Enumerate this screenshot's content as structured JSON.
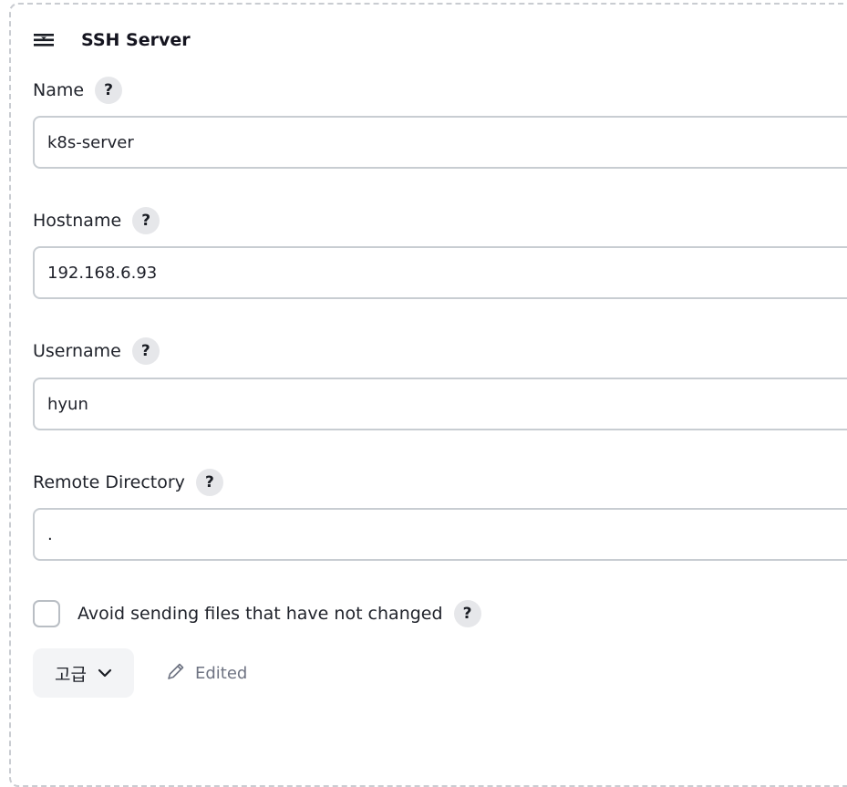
{
  "header": {
    "title": "SSH Server",
    "drag_icon": "drag-handle-icon"
  },
  "fields": {
    "name": {
      "label": "Name",
      "value": "k8s-server",
      "help": "?"
    },
    "hostname": {
      "label": "Hostname",
      "value": "192.168.6.93",
      "help": "?"
    },
    "username": {
      "label": "Username",
      "value": "hyun",
      "help": "?"
    },
    "remote_directory": {
      "label": "Remote Directory",
      "value": ".",
      "help": "?"
    }
  },
  "options": {
    "avoid_sending": {
      "label": "Avoid sending files that have not changed",
      "checked": false,
      "help": "?"
    }
  },
  "advanced": {
    "label": "고급",
    "icon": "chevron-down-icon"
  },
  "status": {
    "edited_label": "Edited",
    "icon": "pencil-icon"
  },
  "colors": {
    "border": "#c8cdd2",
    "help_bg": "#e6e7ea",
    "button_bg": "#f3f4f6",
    "muted_text": "#6e7382"
  }
}
